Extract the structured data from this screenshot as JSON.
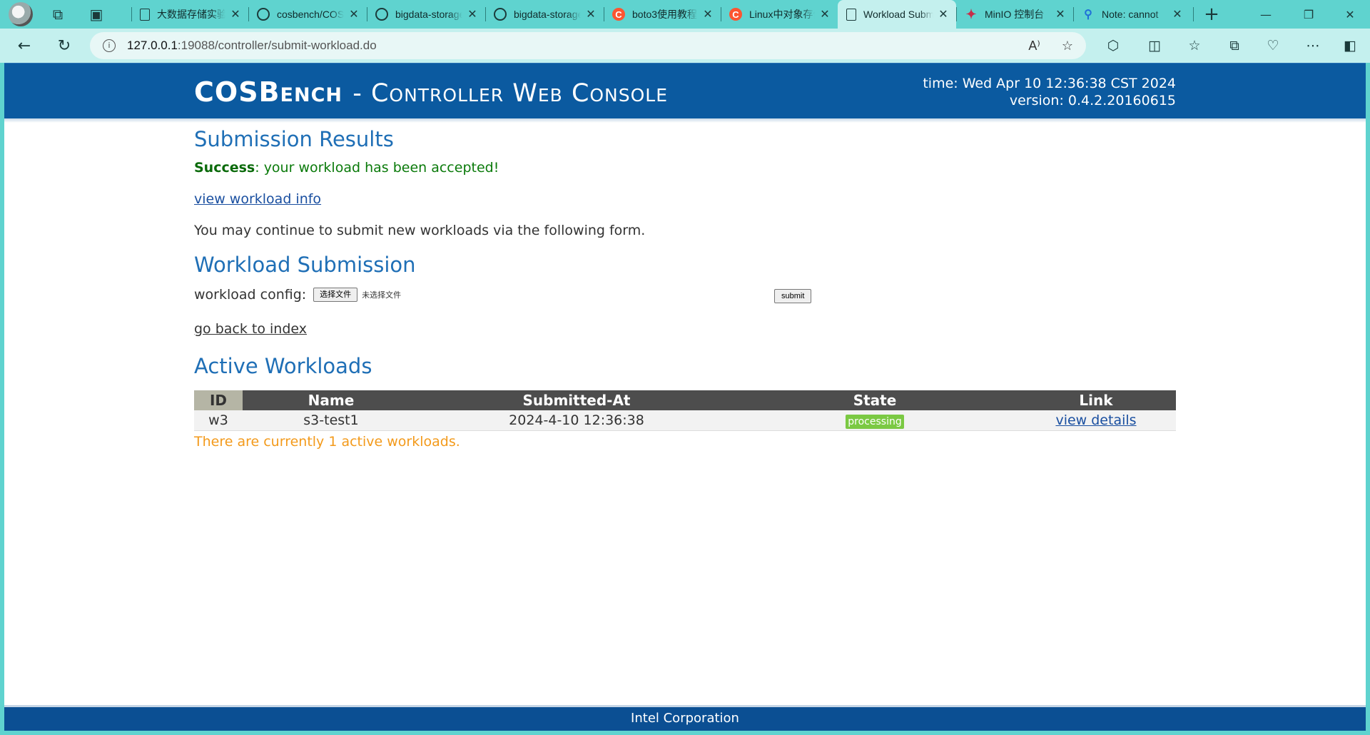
{
  "browser": {
    "tabs": [
      {
        "favicon": "doc",
        "title": "大数据存储实验"
      },
      {
        "favicon": "github",
        "title": "cosbench/COSBench"
      },
      {
        "favicon": "github",
        "title": "bigdata-storage"
      },
      {
        "favicon": "github",
        "title": "bigdata-storage"
      },
      {
        "favicon": "csdn",
        "favicon_letter": "C",
        "title": "boto3使用教程"
      },
      {
        "favicon": "csdn",
        "favicon_letter": "C",
        "title": "Linux中对象存储"
      },
      {
        "favicon": "doc",
        "title": "Workload Submission",
        "active": true
      },
      {
        "favicon": "minio",
        "title": "MinIO 控制台"
      },
      {
        "favicon": "search",
        "title": "Note: cannot"
      }
    ],
    "close_glyph": "✕",
    "new_tab_glyph": "+",
    "url_host": "127.0.0.1",
    "url_path": ":19088/controller/submit-workload.do"
  },
  "header": {
    "brand_main": "COSBench",
    "brand_sub": "- Controller Web Console",
    "time": "time: Wed Apr 10 12:36:38 CST 2024",
    "version": "version: 0.4.2.20160615"
  },
  "results": {
    "heading": "Submission Results",
    "success_label": "Success",
    "success_text": ": your workload has been accepted!",
    "view_link": "view workload info",
    "continue_text": "You may continue to submit new workloads via the following form."
  },
  "submission": {
    "heading": "Workload Submission",
    "config_label": "workload config:",
    "file_button": "选择文件",
    "no_file": "未选择文件",
    "submit_button": "submit",
    "back_link": "go back to index"
  },
  "active": {
    "heading": "Active Workloads",
    "columns": [
      "ID",
      "Name",
      "Submitted-At",
      "State",
      "Link"
    ],
    "rows": [
      {
        "id": "w3",
        "name": "s3-test1",
        "submitted": "2024-4-10 12:36:38",
        "state": "processing",
        "link": "view details"
      }
    ],
    "summary": "There are currently 1 active workloads."
  },
  "footer": {
    "text": "Intel Corporation"
  },
  "colors": {
    "header": "#0b5aa0",
    "heading": "#1f6fb6",
    "success": "#0a7a0a",
    "warning": "#f39a1b",
    "badge": "#7bc943",
    "browser_frame": "#5fd3cf"
  }
}
